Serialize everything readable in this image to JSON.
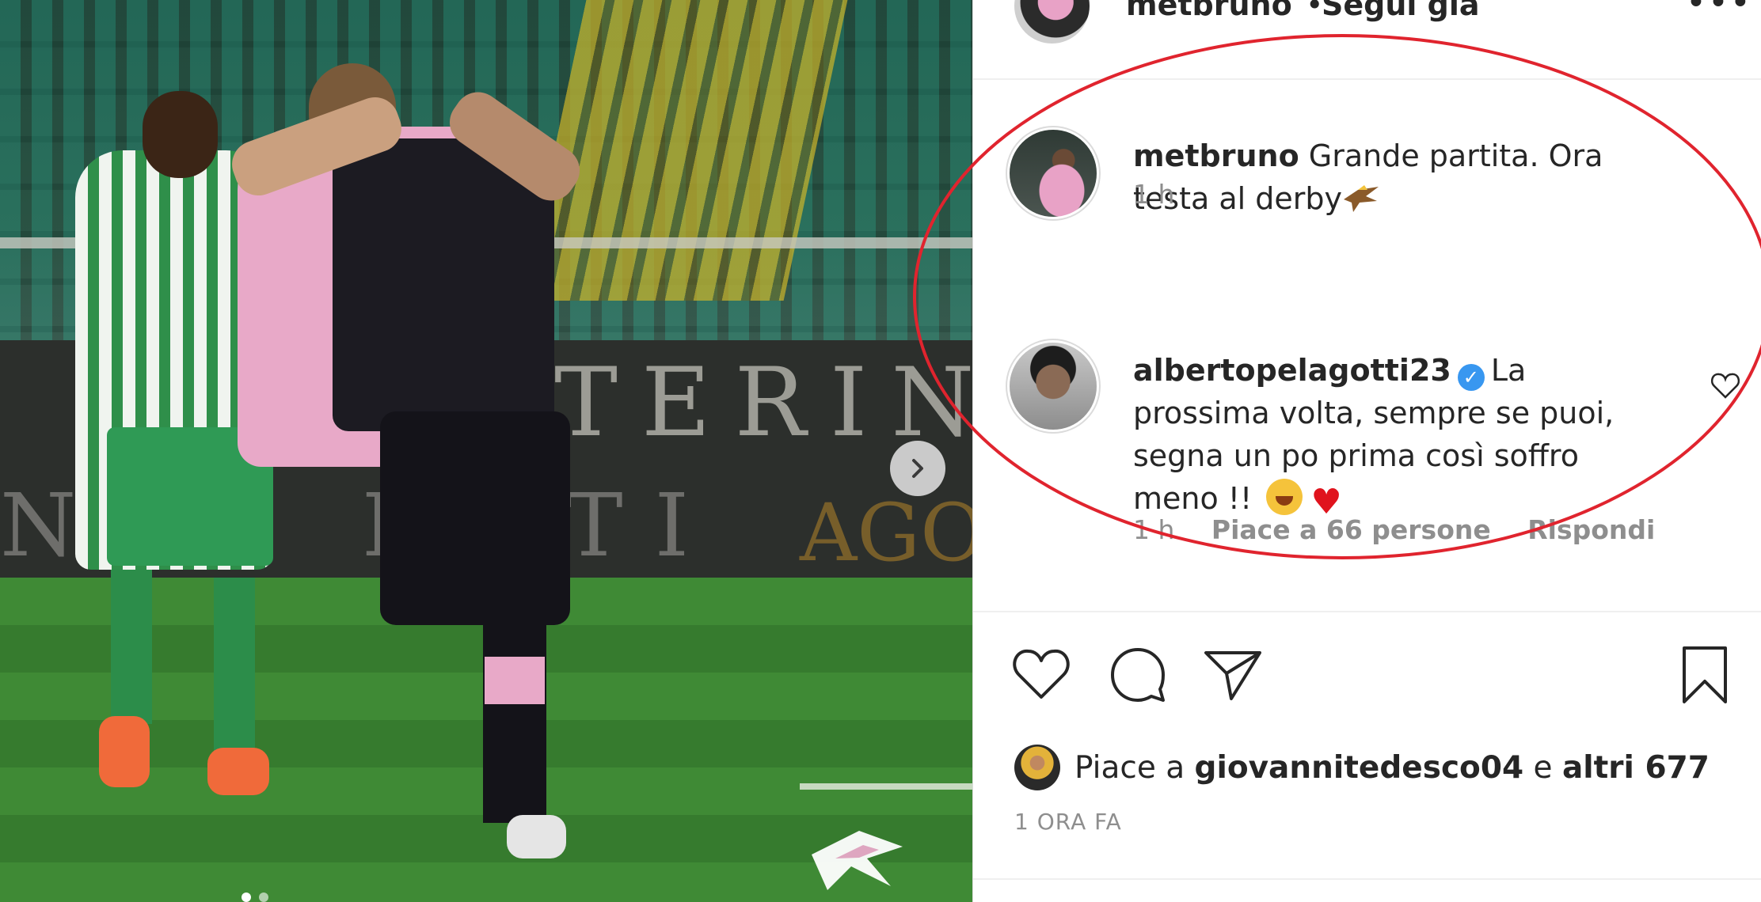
{
  "photo": {
    "stadium_text_1": "TERIN",
    "stadium_text_2": "NSO  ENTI",
    "stadium_text_3": "AGOR",
    "carousel_dots": 2,
    "active_dot": 1
  },
  "header": {
    "username": "metbruno",
    "separator": "•",
    "follow_status": "Segui già",
    "more_label": "•••"
  },
  "comments": [
    {
      "username": "metbruno",
      "text": "Grande partita. Ora testa al derby",
      "emoji": "eagle",
      "time": "1 h"
    },
    {
      "username": "albertopelagotti23",
      "verified": true,
      "text": "La prossima volta, sempre se puoi, segna un po prima così soffro meno !!",
      "emojis": [
        "rolling-on-floor-laughing",
        "red-heart"
      ],
      "time": "1 h",
      "likes_label": "Piace a 66 persone",
      "reply_label": "Rispondi"
    }
  ],
  "likes": {
    "prefix": "Piace a",
    "user": "giovannitedesco04",
    "connector": "e",
    "others": "altri 677"
  },
  "timestamp": "1 ORA FA",
  "colors": {
    "text": "#262626",
    "secondary": "#8e8e8e",
    "verified": "#3897f0",
    "annotation": "#e0242e",
    "heart": "#e0131d"
  }
}
